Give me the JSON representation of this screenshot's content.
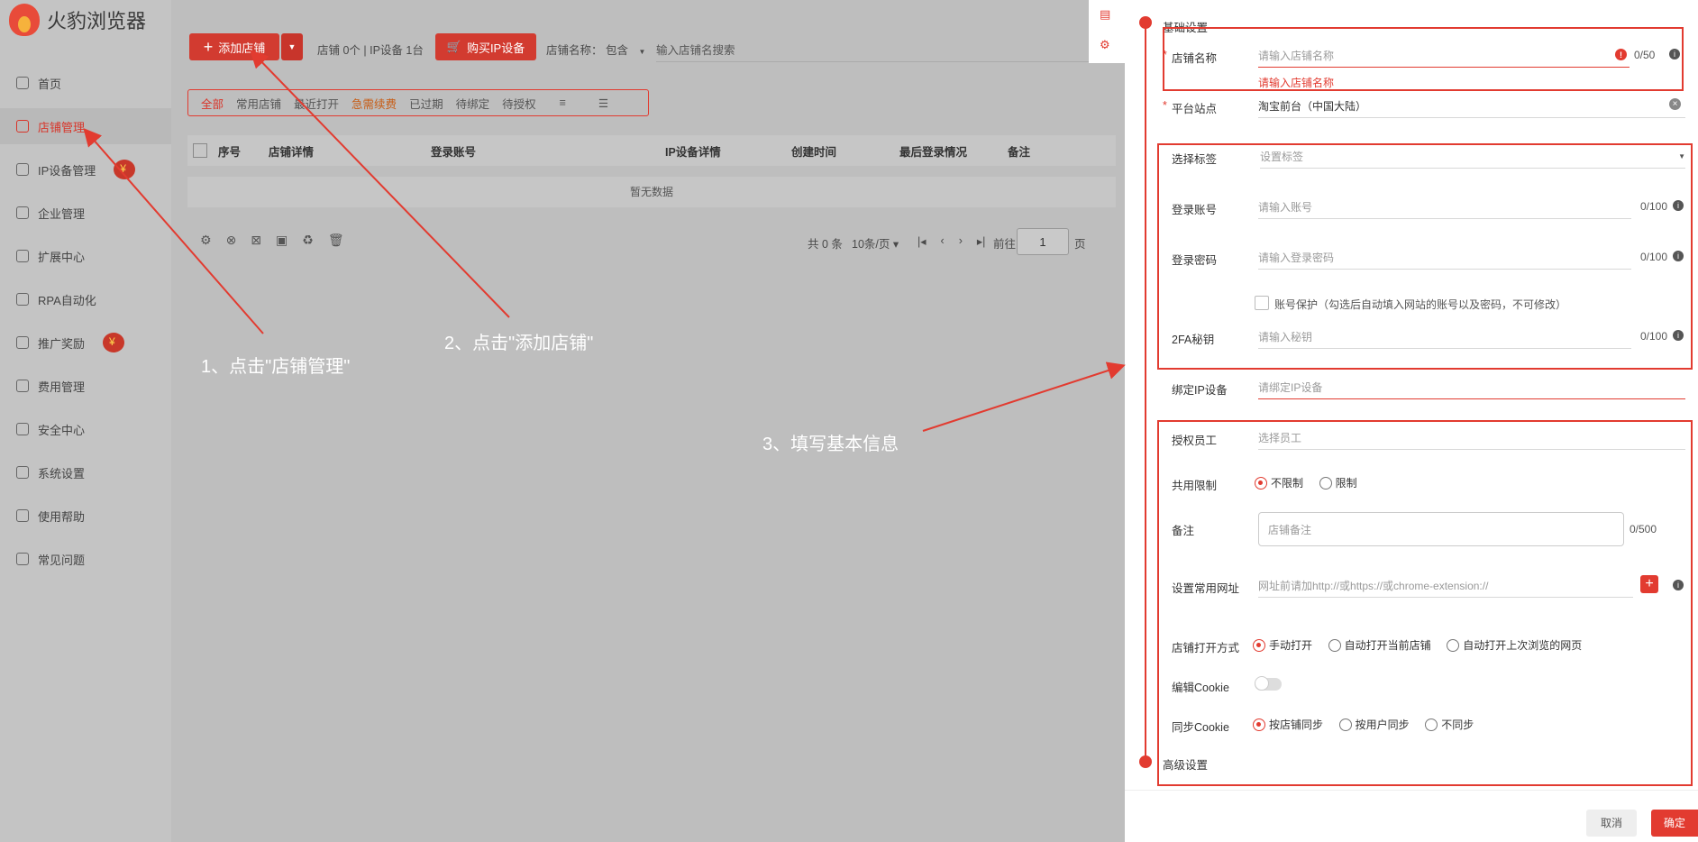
{
  "app": {
    "name": "火豹浏览器"
  },
  "sidebar": {
    "items": [
      {
        "label": "首页",
        "icon": "home-icon"
      },
      {
        "label": "店铺管理",
        "icon": "store-icon",
        "active": true
      },
      {
        "label": "IP设备管理",
        "icon": "location-icon"
      },
      {
        "label": "企业管理",
        "icon": "team-icon"
      },
      {
        "label": "扩展中心",
        "icon": "extension-icon"
      },
      {
        "label": "RPA自动化",
        "icon": "robot-icon"
      },
      {
        "label": "推广奖励",
        "icon": "gift-icon"
      },
      {
        "label": "费用管理",
        "icon": "billing-icon"
      },
      {
        "label": "安全中心",
        "icon": "shield-icon"
      },
      {
        "label": "系统设置",
        "icon": "gear-icon"
      },
      {
        "label": "使用帮助",
        "icon": "help-icon"
      },
      {
        "label": "常见问题",
        "icon": "faq-icon"
      }
    ]
  },
  "toolbar": {
    "add_store": "添加店铺",
    "store_stats": "店铺 0个 | IP设备 1台",
    "buy_ip": "购买IP设备",
    "name_filter_label": "店铺名称：",
    "name_filter_value": "包含",
    "search_placeholder": "输入店铺名搜索"
  },
  "filters": [
    "全部",
    "常用店铺",
    "最近打开",
    "急需续费",
    "已过期",
    "待绑定",
    "待授权"
  ],
  "table": {
    "headers": [
      "序号",
      "店铺详情",
      "登录账号",
      "IP设备详情",
      "创建时间",
      "最后登录情况",
      "备注"
    ],
    "empty_text": "暂无数据"
  },
  "pagination": {
    "total": "共 0 条",
    "page_size": "10条/页",
    "goto_label": "前往",
    "page": "1",
    "page_suffix": "页"
  },
  "annotations": {
    "step1": "1、点击\"店铺管理\"",
    "step2": "2、点击\"添加店铺\"",
    "step3": "3、填写基本信息"
  },
  "form": {
    "section_basic": "基础设置",
    "section_advanced": "高级设置",
    "store_name": {
      "label": "店铺名称",
      "placeholder": "请输入店铺名称",
      "count": "0/50",
      "error": "请输入店铺名称"
    },
    "platform": {
      "label": "平台站点",
      "value": "淘宝前台（中国大陆）"
    },
    "tags": {
      "label": "选择标签",
      "placeholder": "设置标签"
    },
    "account": {
      "label": "登录账号",
      "placeholder": "请输入账号",
      "count": "0/100"
    },
    "password": {
      "label": "登录密码",
      "placeholder": "请输入登录密码",
      "count": "0/100"
    },
    "account_protect": "账号保护（勾选后自动填入网站的账号以及密码，不可修改）",
    "twofa": {
      "label": "2FA秘钥",
      "placeholder": "请输入秘钥",
      "count": "0/100"
    },
    "bind_ip": {
      "label": "绑定IP设备",
      "placeholder": "请绑定IP设备"
    },
    "staff": {
      "label": "授权员工",
      "placeholder": "选择员工"
    },
    "share": {
      "label": "共用限制",
      "options": [
        "不限制",
        "限制"
      ]
    },
    "remark": {
      "label": "备注",
      "placeholder": "店铺备注",
      "count": "0/500"
    },
    "urls": {
      "label": "设置常用网址",
      "placeholder": "网址前请加http://或https://或chrome-extension://"
    },
    "open_mode": {
      "label": "店铺打开方式",
      "options": [
        "手动打开",
        "自动打开当前店铺",
        "自动打开上次浏览的网页"
      ]
    },
    "edit_cookie": {
      "label": "编辑Cookie"
    },
    "sync_cookie": {
      "label": "同步Cookie",
      "options": [
        "按店铺同步",
        "按用户同步",
        "不同步"
      ]
    },
    "cancel": "取消",
    "confirm": "确定"
  },
  "colors": {
    "accent": "#e23b30"
  }
}
